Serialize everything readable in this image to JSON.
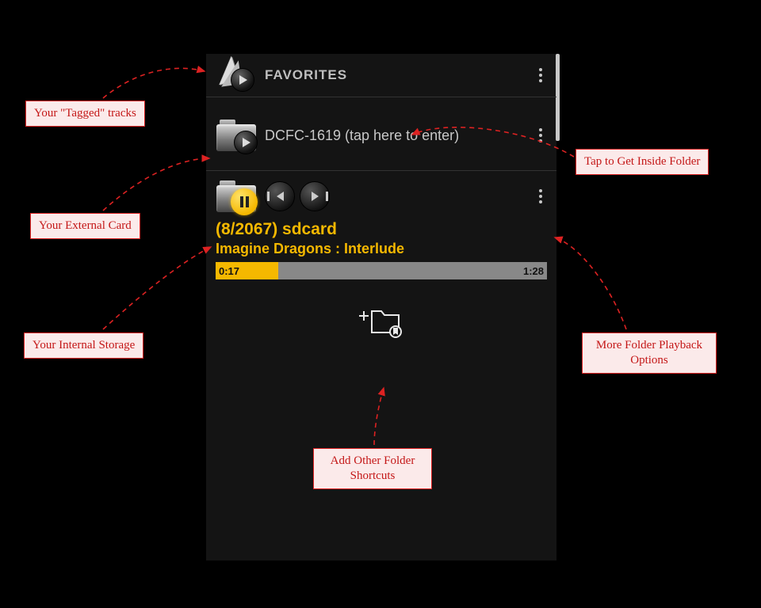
{
  "favorites": {
    "header_label": "FAVORITES"
  },
  "folder1": {
    "label": "DCFC-1619 (tap here to enter)"
  },
  "nowplaying": {
    "counter": "(8/2067)  sdcard",
    "track": "Imagine Dragons : Interlude",
    "time_elapsed": "0:17",
    "time_total": "1:28",
    "progress_pct": 19
  },
  "callouts": {
    "tagged": "Your \"Tagged\" tracks",
    "external": "Your External Card",
    "internal": "Your Internal Storage",
    "inside": "Tap to Get Inside Folder",
    "more": "More Folder Playback Options",
    "add": "Add Other Folder Shortcuts"
  }
}
